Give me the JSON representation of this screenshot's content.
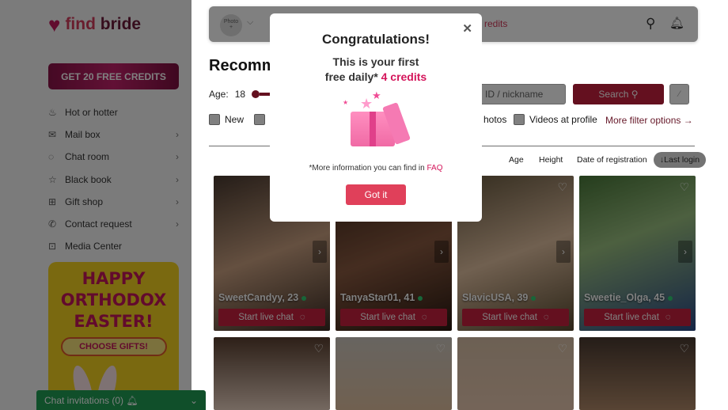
{
  "brand": {
    "name_part1": "find",
    "name_part2": "bride"
  },
  "sidebar": {
    "credits_button": "GET 20 FREE CREDITS",
    "items": [
      {
        "label": "Hot or hotter",
        "icon": "flame-icon",
        "chevron": false
      },
      {
        "label": "Mail box",
        "icon": "mail-icon",
        "chevron": true
      },
      {
        "label": "Chat room",
        "icon": "chat-icon",
        "chevron": true
      },
      {
        "label": "Black book",
        "icon": "star-icon",
        "chevron": true
      },
      {
        "label": "Gift shop",
        "icon": "gift-icon",
        "chevron": true
      },
      {
        "label": "Contact request",
        "icon": "phone-icon",
        "chevron": true
      },
      {
        "label": "Media Center",
        "icon": "camera-icon",
        "chevron": false
      }
    ],
    "banner": {
      "line1": "HAPPY",
      "line2": "ORTHODOX",
      "line3": "EASTER!",
      "button": "CHOOSE GIFTS!"
    },
    "chat_invitations": "Chat invitations (0)"
  },
  "topbar": {
    "photo_label": "Photo",
    "photo_plus": "+",
    "credits_text": "redits"
  },
  "main": {
    "title": "Recomm",
    "age_label": "Age:",
    "age_min": "18",
    "id_placeholder": "ID / nickname",
    "search_button": "Search",
    "filters": [
      "New",
      "",
      "hotos",
      "Videos at profile"
    ],
    "more_filters": "More filter options →",
    "sort": {
      "options": [
        "Age",
        "Height",
        "Date of registration"
      ],
      "active": "↓Last login"
    },
    "chat_button": "Start live chat",
    "profiles": [
      {
        "name": "SweetCandyy, 23",
        "online": true
      },
      {
        "name": "TanyaStar01, 41",
        "online": true
      },
      {
        "name": "SlavicUSA, 39",
        "online": true
      },
      {
        "name": "Sweetie_Olga, 45",
        "online": true
      }
    ]
  },
  "modal": {
    "title": "Congratulations!",
    "line1": "This is your first",
    "line2": "free daily*",
    "highlight": "4 credits",
    "info": "*More information you can find in",
    "faq_link": "FAQ",
    "button": "Got it",
    "accent_color": "#d4145a"
  }
}
